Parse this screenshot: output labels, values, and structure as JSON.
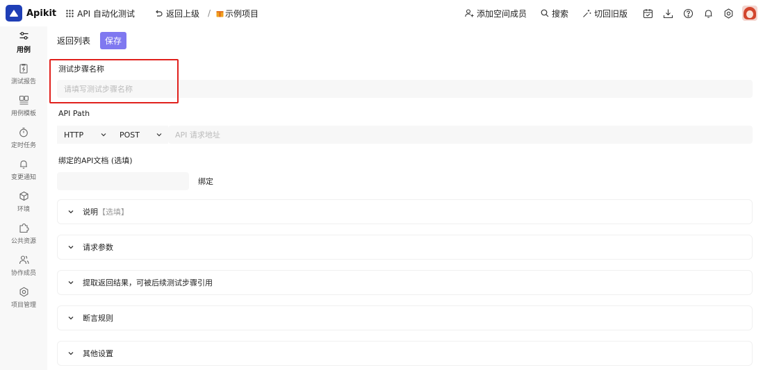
{
  "header": {
    "logo_text": "Apikit",
    "workspace": "API 自动化测试",
    "back_up": "返回上级",
    "separator": "/",
    "project": "示例项目",
    "add_member": "添加空间成员",
    "search": "搜索",
    "switch_old": "切回旧版"
  },
  "sidebar": {
    "items": [
      {
        "label": "用例",
        "icon": "sliders-icon",
        "active": true
      },
      {
        "label": "测试报告",
        "icon": "report-icon"
      },
      {
        "label": "用例模板",
        "icon": "template-icon"
      },
      {
        "label": "定时任务",
        "icon": "timer-icon"
      },
      {
        "label": "变更通知",
        "icon": "bell-icon"
      },
      {
        "label": "环境",
        "icon": "cube-icon"
      },
      {
        "label": "公共资源",
        "icon": "puzzle-icon"
      },
      {
        "label": "协作成员",
        "icon": "users-icon"
      },
      {
        "label": "项目管理",
        "icon": "gear-icon"
      }
    ]
  },
  "toolbar": {
    "back_list": "返回列表",
    "save": "保存"
  },
  "form": {
    "step_name_label": "测试步骤名称",
    "step_name_placeholder": "请填写测试步骤名称",
    "api_path_label": "API Path",
    "protocol": "HTTP",
    "method": "POST",
    "url_placeholder": "API 请求地址",
    "bind_label": "绑定的API文档 (选填)",
    "bind_button": "绑定"
  },
  "panels": [
    {
      "title": "说明",
      "optional": "【选填】"
    },
    {
      "title": "请求参数",
      "optional": ""
    },
    {
      "title": "提取返回结果，可被后续测试步骤引用",
      "optional": ""
    },
    {
      "title": "断言规则",
      "optional": ""
    },
    {
      "title": "其他设置",
      "optional": ""
    }
  ],
  "colors": {
    "brand": "#1f3fb6",
    "save_button": "#7f78f0",
    "highlight_border": "#e0201c"
  }
}
